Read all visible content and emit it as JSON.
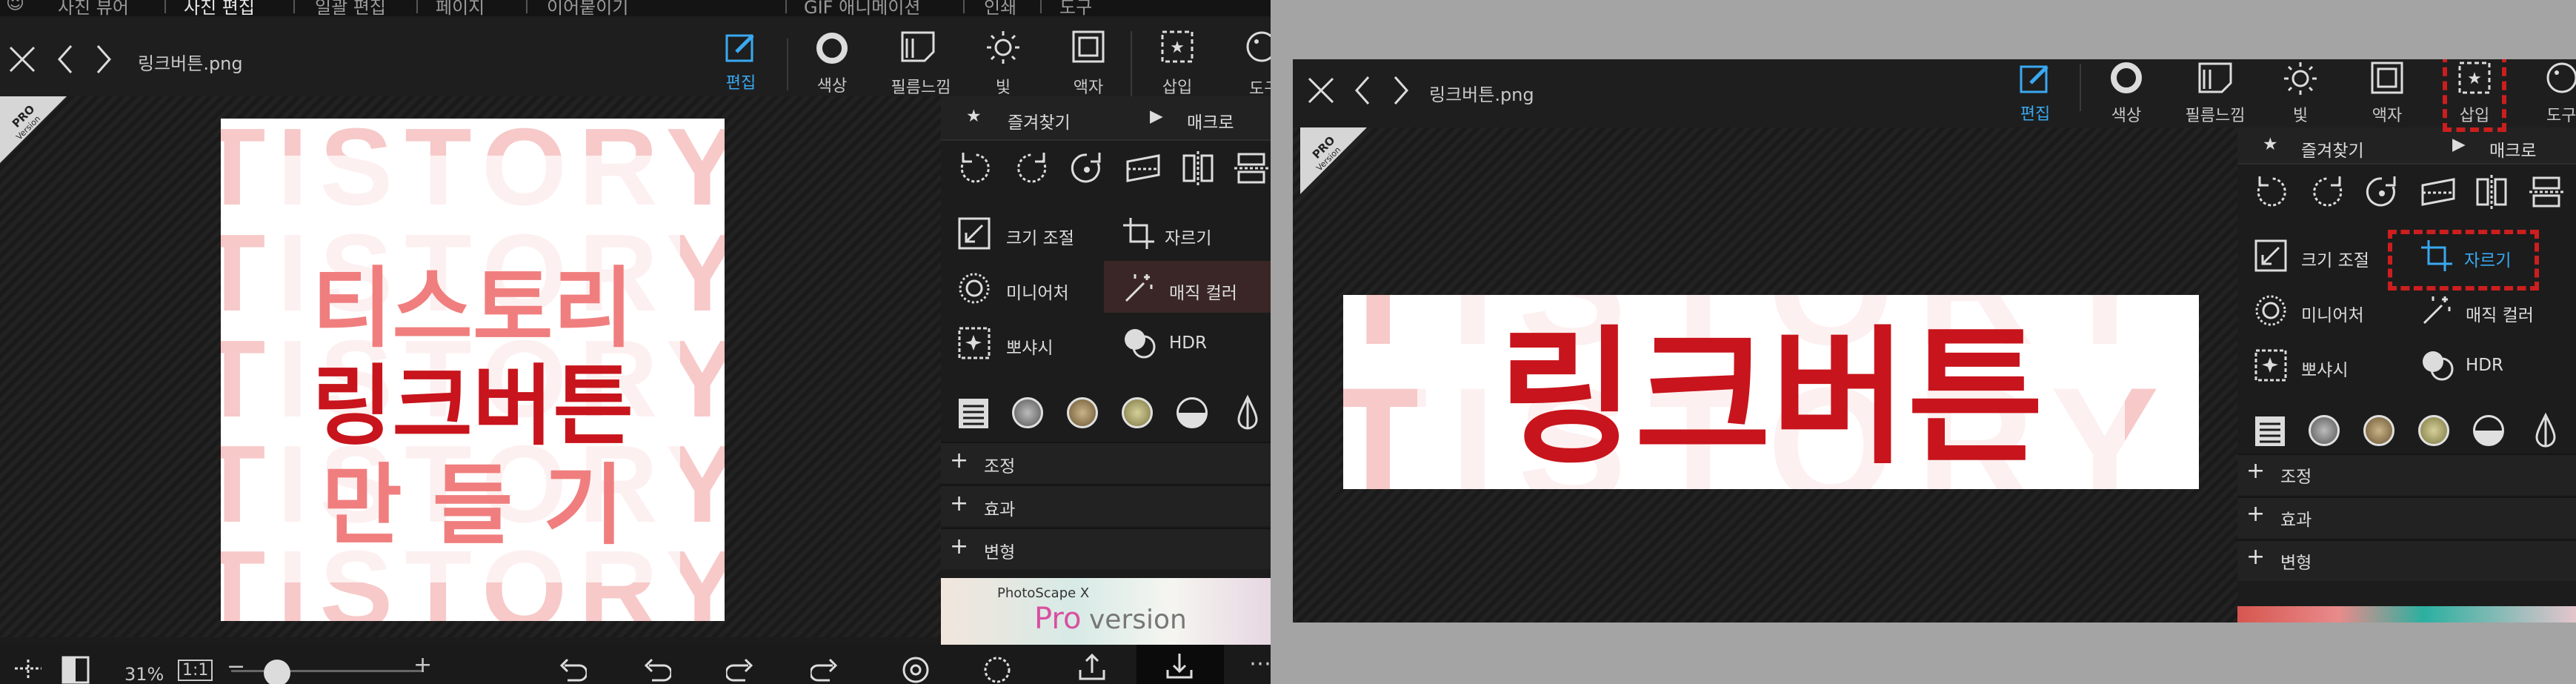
{
  "menubar": {
    "items": [
      "사진 뷰어",
      "사진 편집",
      "일괄 편집",
      "페이지",
      "이어붙이기",
      "GIF 애니메이션",
      "인쇄",
      "도구"
    ]
  },
  "file": {
    "name": "링크버튼.png"
  },
  "toolbar": {
    "tabs": [
      {
        "label": "편집",
        "icon": "edit-icon",
        "active": true
      },
      {
        "label": "색상",
        "icon": "color-icon"
      },
      {
        "label": "필름느낌",
        "icon": "film-icon"
      },
      {
        "label": "빛",
        "icon": "light-icon"
      },
      {
        "label": "액자",
        "icon": "frame-icon"
      },
      {
        "label": "삽입",
        "icon": "insert-icon"
      },
      {
        "label": "도구",
        "icon": "tools-icon"
      }
    ]
  },
  "canvas": {
    "badge_pro": "PRO",
    "badge_version": "Version",
    "art_ghost": "TISTORY",
    "art_line1": "티스토리",
    "art_line2": "링크버튼",
    "art_line3": "만 들 기",
    "colors": {
      "pink": "#f07e7e",
      "red": "#c8141c",
      "ghost": "#f7c9c9"
    }
  },
  "side": {
    "favorites": "즐겨찾기",
    "macro": "매크로",
    "resize": "크기 조절",
    "crop": "자르기",
    "miniature": "미니어처",
    "magic_color": "매직 컬러",
    "bokeh": "뽀샤시",
    "hdr": "HDR",
    "sections": [
      "조정",
      "효과",
      "변형"
    ]
  },
  "ad": {
    "product": "PhotoScape X",
    "pro": "Pro",
    "version": "version"
  },
  "bottom": {
    "zoom": "31%",
    "ratio": "1:1"
  },
  "accent": "#39a9f2",
  "highlight": "#cc1e1e"
}
